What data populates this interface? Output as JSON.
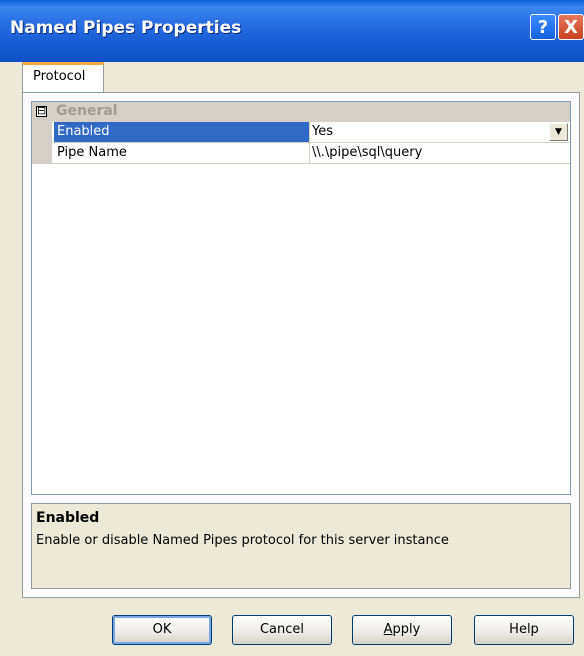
{
  "window": {
    "title": "Named Pipes Properties",
    "help_label": "?",
    "close_label": "X"
  },
  "tabs": [
    {
      "label": "Protocol",
      "selected": true
    }
  ],
  "propgrid": {
    "category": {
      "expander": "⊟",
      "label": "General"
    },
    "properties": [
      {
        "name": "Enabled",
        "value": "Yes",
        "selected": true,
        "has_dropdown": true
      },
      {
        "name": "Pipe Name",
        "value": "\\\\.\\pipe\\sql\\query",
        "selected": false,
        "has_dropdown": false
      }
    ]
  },
  "description": {
    "title": "Enabled",
    "text": "Enable or disable Named Pipes protocol for this server instance"
  },
  "buttons": {
    "ok": "OK",
    "cancel": "Cancel",
    "apply_first": "A",
    "apply_rest": "pply",
    "help": "Help"
  },
  "colors": {
    "titlebar": "#0a5fd8",
    "selection": "#316ac5",
    "tab_highlight": "#f4a742",
    "face": "#ece9d8"
  }
}
